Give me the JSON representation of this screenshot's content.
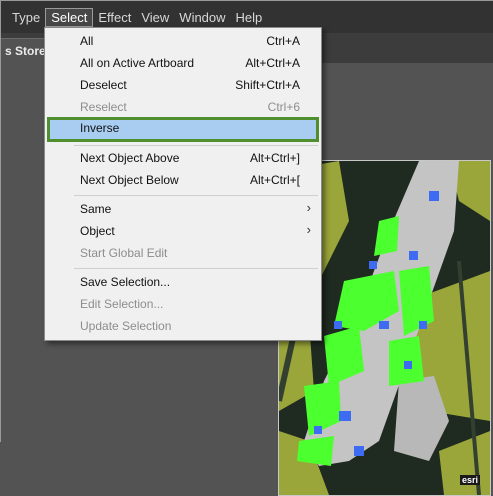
{
  "menubar": {
    "items": [
      "Type",
      "Select",
      "Effect",
      "View",
      "Window",
      "Help"
    ],
    "active": "Select"
  },
  "document_tab": {
    "label": "s Stores*"
  },
  "select_menu": {
    "items": [
      {
        "label": "All",
        "shortcut": "Ctrl+A",
        "enabled": true
      },
      {
        "label": "All on Active Artboard",
        "shortcut": "Alt+Ctrl+A",
        "enabled": true
      },
      {
        "label": "Deselect",
        "shortcut": "Shift+Ctrl+A",
        "enabled": true
      },
      {
        "label": "Reselect",
        "shortcut": "Ctrl+6",
        "enabled": false
      },
      {
        "label": "Inverse",
        "shortcut": "",
        "enabled": true,
        "highlighted": true
      },
      {
        "label": "Next Object Above",
        "shortcut": "Alt+Ctrl+]",
        "enabled": true
      },
      {
        "label": "Next Object Below",
        "shortcut": "Alt+Ctrl+[",
        "enabled": true
      },
      {
        "label": "Same",
        "submenu": true,
        "enabled": true
      },
      {
        "label": "Object",
        "submenu": true,
        "enabled": true
      },
      {
        "label": "Start Global Edit",
        "enabled": false
      },
      {
        "label": "Save Selection...",
        "enabled": true
      },
      {
        "label": "Edit Selection...",
        "enabled": false
      },
      {
        "label": "Update Selection",
        "enabled": false
      }
    ]
  },
  "map": {
    "watermark": "esri"
  },
  "colors": {
    "highlight_fill": "#a8cdf1",
    "highlight_border": "#4f8f2d",
    "map_green": "#4cff2e",
    "map_blue": "#3d6cf2",
    "map_gray": "#c4c4c4",
    "map_olive": "#9aa53a"
  }
}
